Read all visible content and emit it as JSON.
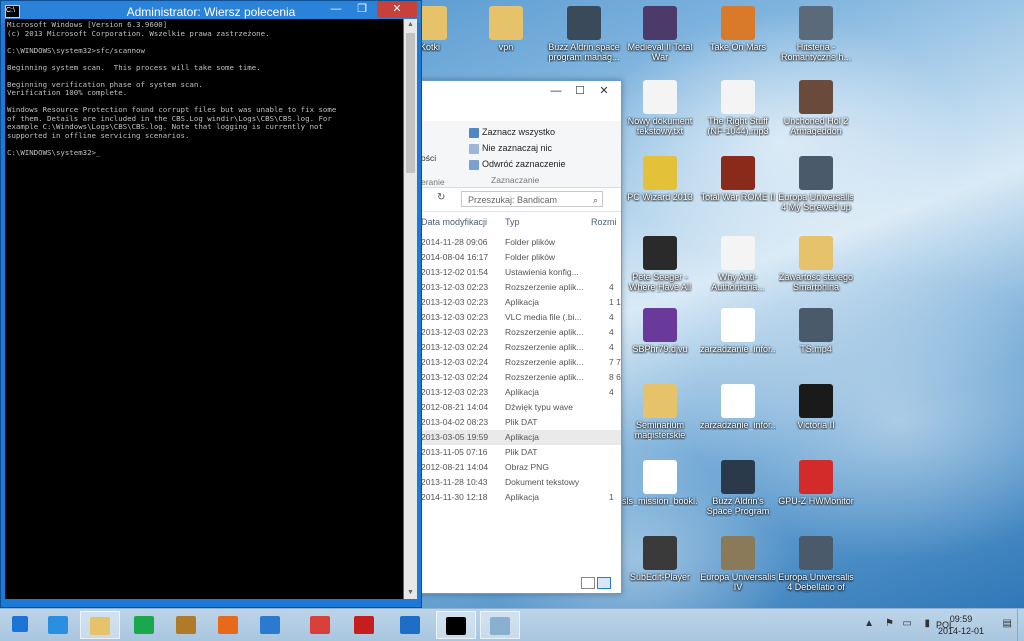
{
  "cmd": {
    "title": "Administrator: Wiersz polecenia",
    "app_icon_text": "C:\\",
    "console_text": "Microsoft Windows [Version 6.3.9600]\n(c) 2013 Microsoft Corporation. Wszelkie prawa zastrzeżone.\n\nC:\\WINDOWS\\system32>sfc/scannow\n\nBeginning system scan.  This process will take some time.\n\nBeginning verification phase of system scan.\nVerification 100% complete.\n\nWindows Resource Protection found corrupt files but was unable to fix some\nof them. Details are included in the CBS.Log windir\\Logs\\CBS\\CBS.log. For\nexample C:\\Windows\\Logs\\CBS\\CBS.log. Note that logging is currently not\nsupported in offline servicing scenarios.\n\nC:\\WINDOWS\\system32>_",
    "btn_min": "—",
    "btn_max": "❐",
    "btn_close": "✕"
  },
  "explorer": {
    "btn_min": "—",
    "btn_max": "☐",
    "btn_close": "✕",
    "ribbon": {
      "left_partial": "ości",
      "left_group_partial": "eranie",
      "select_all": "Zaznacz wszystko",
      "select_none": "Nie zaznaczaj nic",
      "invert_selection": "Odwróć zaznaczenie",
      "group_label": "Zaznaczanie"
    },
    "search_placeholder": "Przeszukaj: Bandicam",
    "columns": {
      "date": "Data modyfikacji",
      "type": "Typ",
      "size": "Rozmi"
    },
    "rows": [
      {
        "date": "2014-11-28 09:06",
        "type": "Folder plików",
        "size": ""
      },
      {
        "date": "2014-08-04 16:17",
        "type": "Folder plików",
        "size": ""
      },
      {
        "date": "2013-12-02 01:54",
        "type": "Ustawienia konfig...",
        "size": ""
      },
      {
        "date": "2013-12-03 02:23",
        "type": "Rozszerzenie aplik...",
        "size": "4"
      },
      {
        "date": "2013-12-03 02:23",
        "type": "Aplikacja",
        "size": "1 1"
      },
      {
        "date": "2013-12-03 02:23",
        "type": "VLC media file (.bi...",
        "size": "4"
      },
      {
        "date": "2013-12-03 02:23",
        "type": "Rozszerzenie aplik...",
        "size": "4"
      },
      {
        "date": "2013-12-03 02:24",
        "type": "Rozszerzenie aplik...",
        "size": "4"
      },
      {
        "date": "2013-12-03 02:24",
        "type": "Rozszerzenie aplik...",
        "size": "7 7"
      },
      {
        "date": "2013-12-03 02:24",
        "type": "Rozszerzenie aplik...",
        "size": "8 6"
      },
      {
        "date": "2013-12-03 02:23",
        "type": "Aplikacja",
        "size": "4"
      },
      {
        "date": "2012-08-21 14:04",
        "type": "Dźwięk typu wave",
        "size": ""
      },
      {
        "date": "2013-04-02 08:23",
        "type": "Plik DAT",
        "size": ""
      },
      {
        "date": "2013-03-05 19:59",
        "type": "Aplikacja",
        "size": ""
      },
      {
        "date": "2013-11-05 07:16",
        "type": "Plik DAT",
        "size": ""
      },
      {
        "date": "2012-08-21 14:04",
        "type": "Obraz PNG",
        "size": ""
      },
      {
        "date": "2013-11-28 10:43",
        "type": "Dokument tekstowy",
        "size": ""
      },
      {
        "date": "2014-11-30 12:18",
        "type": "Aplikacja",
        "size": "1"
      }
    ]
  },
  "desktop_icons": [
    {
      "label": "Kotki",
      "color": "#e6c36a"
    },
    {
      "label": "vpn",
      "color": "#e6c36a"
    },
    {
      "label": "Buzz Aldrin space program manag...",
      "color": "#3a4a5a"
    },
    {
      "label": "Medieval II Total War",
      "color": "#4b3a6a"
    },
    {
      "label": "Take On Mars",
      "color": "#d97a2b"
    },
    {
      "label": "Hitsteria - Romantyczne h...",
      "color": "#5a6a7a"
    },
    {
      "label": "Nowy dokument tekstowy.txt",
      "color": "#f4f4f4"
    },
    {
      "label": "The Right Stuff (NF-1044).mp3",
      "color": "#f4f4f4"
    },
    {
      "label": "Unchoned Hol 2 Armageddon",
      "color": "#6a4a3a"
    },
    {
      "label": "PC Wizard 2013",
      "color": "#e3c23a"
    },
    {
      "label": "Total War ROME II",
      "color": "#8a2a1a"
    },
    {
      "label": "Europa Universalis 4 My Screwed up P...",
      "color": "#4a5a6a"
    },
    {
      "label": "Pete Seeger - Where Have All The Flow...",
      "color": "#2a2a2a"
    },
    {
      "label": "Why Anti-Authoritaria...",
      "color": "#f4f4f4"
    },
    {
      "label": "Zawartość starego Smartphina",
      "color": "#e6c36a"
    },
    {
      "label": "SBPhr79.djvu",
      "color": "#6a3a9a"
    },
    {
      "label": "zarzadzanie_infor...",
      "color": "#ffffff"
    },
    {
      "label": "TS.mp4",
      "color": "#4a5a6a"
    },
    {
      "label": "Seminarium magisterskie",
      "color": "#e6c36a"
    },
    {
      "label": "zarzadzanie_infor...",
      "color": "#ffffff"
    },
    {
      "label": "Victoria II",
      "color": "#1a1a1a"
    },
    {
      "label": "sls_mission_bookl...",
      "color": "#ffffff"
    },
    {
      "label": "Buzz Aldrin's Space Program Manager",
      "color": "#2a3a4a"
    },
    {
      "label": "GPU-Z HWMonitor",
      "color": "#d32a2a"
    },
    {
      "label": "SubEdit-Player",
      "color": "#3a3a3a"
    },
    {
      "label": "Europa Universalis IV",
      "color": "#8a7a5a"
    },
    {
      "label": "Europa Universalis 4 Debellatio of Port...",
      "color": "#4a5a6a"
    }
  ],
  "partial_explorer_icon_label": "...",
  "taskbar": {
    "items": [
      {
        "name": "windows-start",
        "color": "#1e74d6"
      },
      {
        "name": "internet-explorer",
        "color": "#2b8fe0"
      },
      {
        "name": "file-explorer",
        "color": "#e6c36a"
      },
      {
        "name": "store",
        "color": "#1aa84e"
      },
      {
        "name": "game-box",
        "color": "#b07a2a"
      },
      {
        "name": "firefox",
        "color": "#e66a1a"
      },
      {
        "name": "teamviewer",
        "color": "#2a7ad0"
      },
      {
        "name": "chrome",
        "color": "#d9403a"
      },
      {
        "name": "acrobat",
        "color": "#c41e1e"
      },
      {
        "name": "mail",
        "color": "#1c6fc4"
      },
      {
        "name": "command-prompt",
        "color": "#000000"
      },
      {
        "name": "photo-viewer",
        "color": "#8ab0d0"
      }
    ],
    "language": "POL",
    "time": "09:59",
    "date": "2014-12-01"
  }
}
